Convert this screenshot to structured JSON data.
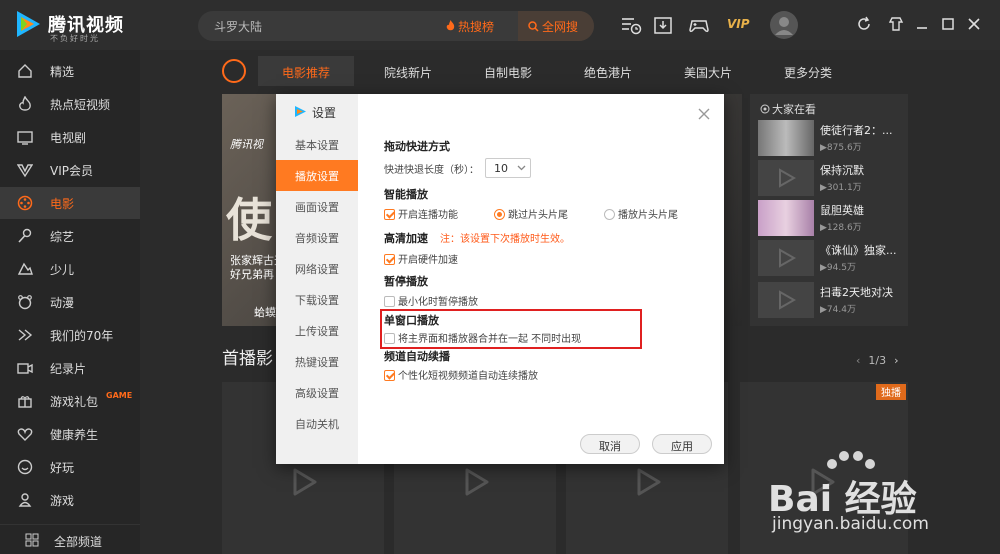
{
  "app": {
    "name": "腾讯视频",
    "slogan": "不负好时光"
  },
  "search": {
    "query": "斗罗大陆",
    "hot_label": "热搜榜",
    "all_web_label": "全网搜"
  },
  "header": {
    "vip_label": "VIP"
  },
  "sidebar": {
    "items": [
      {
        "label": "精选",
        "icon": "home-icon"
      },
      {
        "label": "热点短视频",
        "icon": "flame-icon"
      },
      {
        "label": "电视剧",
        "icon": "tv-icon"
      },
      {
        "label": "VIP会员",
        "icon": "vip-icon"
      },
      {
        "label": "电影",
        "icon": "film-reel-icon",
        "active": true
      },
      {
        "label": "综艺",
        "icon": "mic-icon"
      },
      {
        "label": "少儿",
        "icon": "child-icon"
      },
      {
        "label": "动漫",
        "icon": "bear-icon"
      },
      {
        "label": "我们的70年",
        "icon": "flag-icon"
      },
      {
        "label": "纪录片",
        "icon": "camera-icon"
      },
      {
        "label": "游戏礼包",
        "icon": "gift-icon",
        "badge": "GAME"
      },
      {
        "label": "健康养生",
        "icon": "heart-icon"
      },
      {
        "label": "好玩",
        "icon": "smile-icon"
      },
      {
        "label": "游戏",
        "icon": "gamepad-icon"
      }
    ],
    "all_channels": "全部频道"
  },
  "tabs": [
    {
      "label": "电影推荐",
      "active": true
    },
    {
      "label": "院线新片"
    },
    {
      "label": "自制电影"
    },
    {
      "label": "绝色港片"
    },
    {
      "label": "美国大片"
    },
    {
      "label": "更多分类"
    }
  ],
  "banner": {
    "big_char": "使",
    "brand": "腾讯视",
    "line1": "张家辉古天",
    "line2": "好兄弟再",
    "line3": "蛤蟆"
  },
  "watching": {
    "title": "大家在看",
    "items": [
      {
        "name": "使徒行者2：...",
        "count": "▶875.6万"
      },
      {
        "name": "保持沉默",
        "count": "▶301.1万"
      },
      {
        "name": "鼠胆英雄",
        "count": "▶128.6万"
      },
      {
        "name": "《诛仙》独家...",
        "count": "▶94.5万"
      },
      {
        "name": "扫毒2天地对决",
        "count": "▶74.4万"
      }
    ]
  },
  "section": {
    "title": "首播影",
    "pager": "1/3",
    "exclusive_label": "独播"
  },
  "dialog": {
    "title": "设置",
    "nav": [
      {
        "label": "基本设置"
      },
      {
        "label": "播放设置",
        "active": true
      },
      {
        "label": "画面设置"
      },
      {
        "label": "音频设置"
      },
      {
        "label": "网络设置"
      },
      {
        "label": "下载设置"
      },
      {
        "label": "上传设置"
      },
      {
        "label": "热键设置"
      },
      {
        "label": "高级设置"
      },
      {
        "label": "自动关机"
      }
    ],
    "seek": {
      "heading": "拖动快进方式",
      "label": "快进快退长度（秒）：",
      "value": "10"
    },
    "smart": {
      "heading": "智能播放",
      "opt1": "开启连播功能",
      "opt2": "跳过片头片尾",
      "opt3": "播放片头片尾"
    },
    "hd": {
      "heading": "高清加速",
      "note": "注：该设置下次播放时生效。",
      "opt": "开启硬件加速"
    },
    "pause": {
      "heading": "暂停播放",
      "opt": "最小化时暂停播放"
    },
    "single": {
      "heading": "单窗口播放",
      "opt": "将主界面和播放器合并在一起 不同时出现"
    },
    "channel": {
      "heading": "频道自动续播",
      "opt": "个性化短视频频道自动连续播放"
    },
    "cancel": "取消",
    "apply": "应用"
  },
  "watermark": {
    "brand": "Bai 经验",
    "url": "jingyan.baidu.com"
  },
  "colors": {
    "accent": "#ff6a1a",
    "sidebar_bg": "#262626",
    "highlight_box": "#e02020"
  }
}
